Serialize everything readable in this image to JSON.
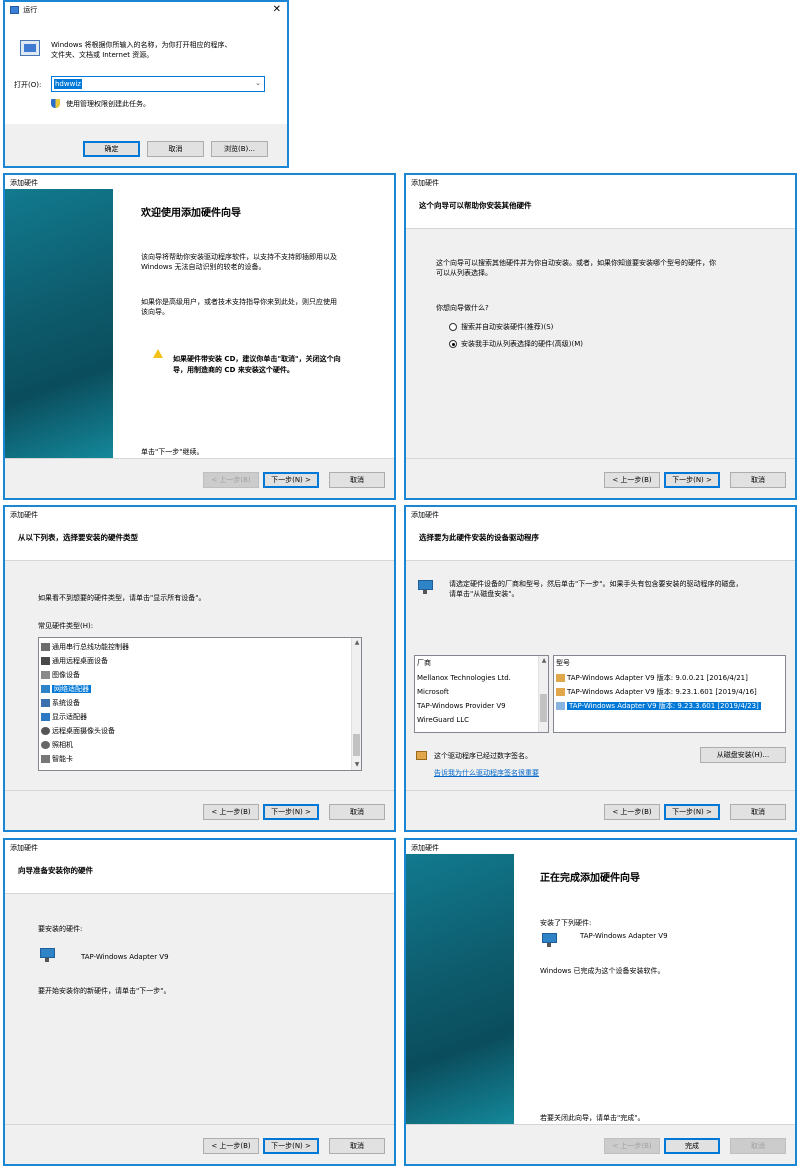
{
  "run": {
    "title": "运行",
    "desc_line1": "Windows 将根据你所输入的名称，为你打开相应的程序、",
    "desc_line2": "文件夹、文档或 Internet 资源。",
    "open_label": "打开(O):",
    "open_value": "hdwwiz",
    "admin_text": "使用管理权限创建此任务。",
    "ok": "确定",
    "cancel": "取消",
    "browse": "浏览(B)..."
  },
  "wizard_title": "添加硬件",
  "buttons": {
    "back": "< 上一步(B)",
    "next": "下一步(N) >",
    "cancel": "取消",
    "finish": "完成"
  },
  "welcome": {
    "heading": "欢迎使用添加硬件向导",
    "p1_l1": "该向导将帮助你安装驱动程序软件，以支持不支持即插即用以及",
    "p1_l2": "Windows 无法自动识别的较老的设备。",
    "p2_l1": "如果你是高级用户，或者技术支持指导你来到此处，则只应使用",
    "p2_l2": "该向导。",
    "warn_l1": "如果硬件带安装 CD，建议你单击\"取消\"，关闭这个向",
    "warn_l2": "导，用制造商的 CD 来安装这个硬件。",
    "footer": "单击\"下一步\"继续。"
  },
  "help": {
    "header": "这个向导可以帮助你安装其他硬件",
    "desc_l1": "这个向导可以搜索其他硬件并为你自动安装。或者，如果你知道要安装哪个型号的硬件，你",
    "desc_l2": "可以从列表选择。",
    "question": "你想向导做什么?",
    "opt1": "搜索并自动安装硬件(推荐)(S)",
    "opt2": "安装我手动从列表选择的硬件(高级)(M)"
  },
  "type_select": {
    "header": "从以下列表，选择要安装的硬件类型",
    "desc": "如果看不到想要的硬件类型，请单击\"显示所有设备\"。",
    "list_label": "常见硬件类型(H):",
    "items": [
      "通用串行总线功能控制器",
      "通用远程桌面设备",
      "图像设备",
      "网络适配器",
      "系统设备",
      "显示适配器",
      "远程桌面摄像头设备",
      "照相机",
      "智能卡"
    ],
    "selected_index": 3
  },
  "driver_select": {
    "header": "选择要为此硬件安装的设备驱动程序",
    "desc_l1": "请选定硬件设备的厂商和型号，然后单击\"下一步\"。如果手头有包含要安装的驱动程序的磁盘，",
    "desc_l2": "请单击\"从磁盘安装\"。",
    "mfr_header": "厂商",
    "mfrs": [
      "Mellanox Technologies Ltd.",
      "Microsoft",
      "TAP-Windows Provider V9",
      "WireGuard LLC"
    ],
    "model_header": "型号",
    "models": [
      "TAP-Windows Adapter V9 版本: 9.0.0.21 [2016/4/21]",
      "TAP-Windows Adapter V9 版本: 9.23.1.601 [2019/4/16]",
      "TAP-Windows Adapter V9 版本: 9.23.3.601 [2019/4/23]"
    ],
    "signed_text": "这个驱动程序已经过数字签名。",
    "signing_link": "告诉我为什么驱动程序签名很重要",
    "have_disk": "从磁盘安装(H)..."
  },
  "ready": {
    "header": "向导准备安装你的硬件",
    "label": "要安装的硬件:",
    "device": "TAP-Windows Adapter V9",
    "footer": "要开始安装你的新硬件，请单击\"下一步\"。"
  },
  "finish": {
    "heading": "正在完成添加硬件向导",
    "installed_label": "安装了下列硬件:",
    "device": "TAP-Windows Adapter V9",
    "done_text": "Windows 已完成为这个设备安装软件。",
    "close_text": "若要关闭此向导，请单击\"完成\"。"
  },
  "colors": {
    "accent": "#0078d7",
    "border": "#1b86d4",
    "link": "#0066cc",
    "sidebar": "#0d5b6c"
  }
}
